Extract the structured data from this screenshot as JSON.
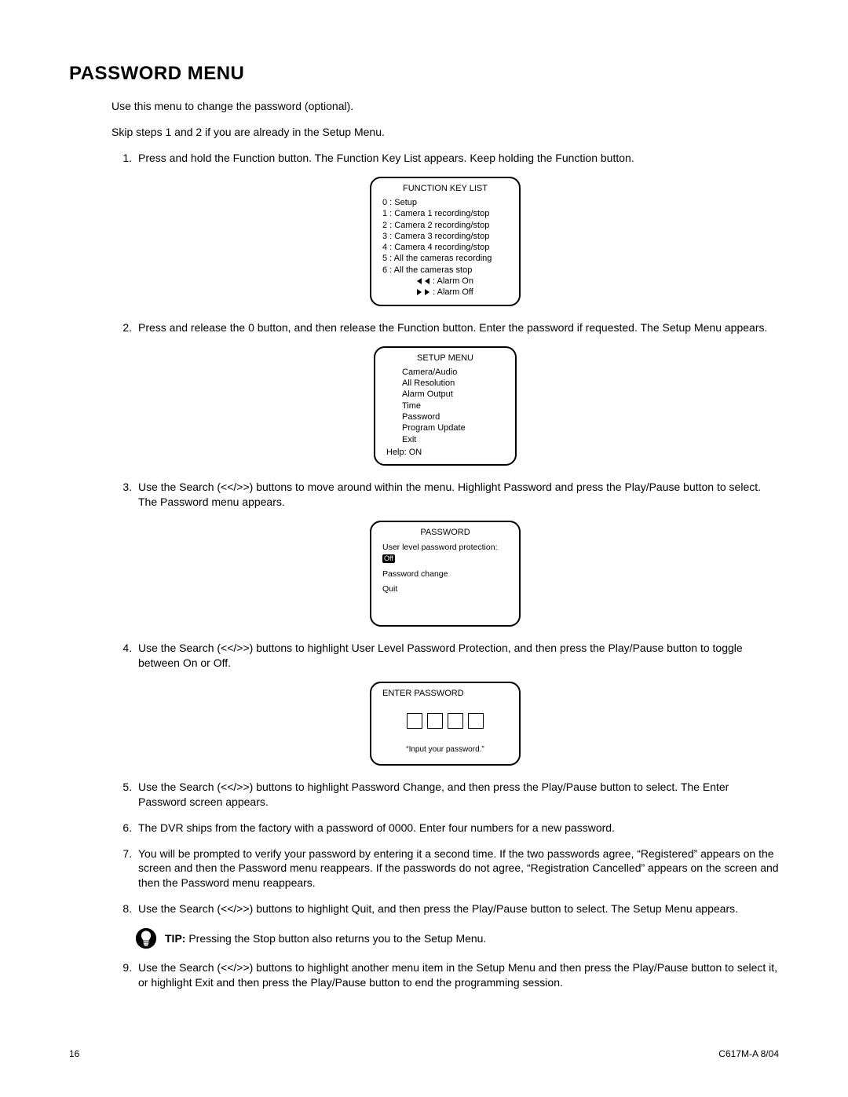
{
  "title": "PASSWORD MENU",
  "intro": [
    "Use this menu to change the password (optional).",
    "Skip steps 1 and 2 if you are already in the Setup Menu."
  ],
  "steps": {
    "s1": "Press and hold the Function button. The Function Key List appears. Keep holding the Function button.",
    "s2": "Press and release the 0 button, and then release the Function button. Enter the password if requested. The Setup Menu appears.",
    "s3": "Use the Search (<</>>) buttons to move around within the menu. Highlight Password and press the Play/Pause button to select. The Password menu appears.",
    "s4": "Use the Search (<</>>) buttons to highlight User Level Password Protection, and then press the Play/Pause button to toggle between On or Off.",
    "s5": "Use the Search (<</>>) buttons to highlight Password Change, and then press the Play/Pause button to select. The Enter Password screen appears.",
    "s6": "The DVR ships from the factory with a password of 0000. Enter four numbers for a new password.",
    "s7": "You will be prompted to verify your password by entering it a second time. If the two passwords agree, “Registered” appears on the screen and then the Password menu reappears. If the passwords do not agree, “Registration Cancelled” appears on the screen and then the Password menu reappears.",
    "s8": "Use the Search (<</>>) buttons to highlight Quit, and then press the Play/Pause button to select. The Setup Menu appears.",
    "s9": "Use the Search (<</>>) buttons to highlight another menu item in the Setup Menu and then press the Play/Pause button to select it, or highlight Exit and then press the Play/Pause button to end the programming session."
  },
  "tip_label": "TIP:",
  "tip_text": "  Pressing the Stop button also returns you to the Setup Menu.",
  "function_key_list": {
    "title": "FUNCTION KEY LIST",
    "items": [
      "0 : Setup",
      "1 : Camera 1 recording/stop",
      "2 : Camera 2 recording/stop",
      "3 : Camera 3 recording/stop",
      "4 : Camera 4 recording/stop",
      "5 : All the cameras recording",
      "6 : All the cameras stop"
    ],
    "alarm_on": ": Alarm On",
    "alarm_off": ": Alarm Off"
  },
  "setup_menu": {
    "title": "SETUP MENU",
    "items": [
      "Camera/Audio",
      "All Resolution",
      "Alarm Output",
      "Time",
      "Password",
      "Program Update",
      "Exit"
    ],
    "help": "Help: ON"
  },
  "password_menu": {
    "title": "PASSWORD",
    "row1_label": "User level password protection:",
    "row1_value": "Off",
    "row2": "Password change",
    "row3": "Quit"
  },
  "enter_password": {
    "title": "ENTER PASSWORD",
    "msg": "“Input your password.”"
  },
  "footer": {
    "left": "16",
    "right": "C617M-A 8/04"
  }
}
